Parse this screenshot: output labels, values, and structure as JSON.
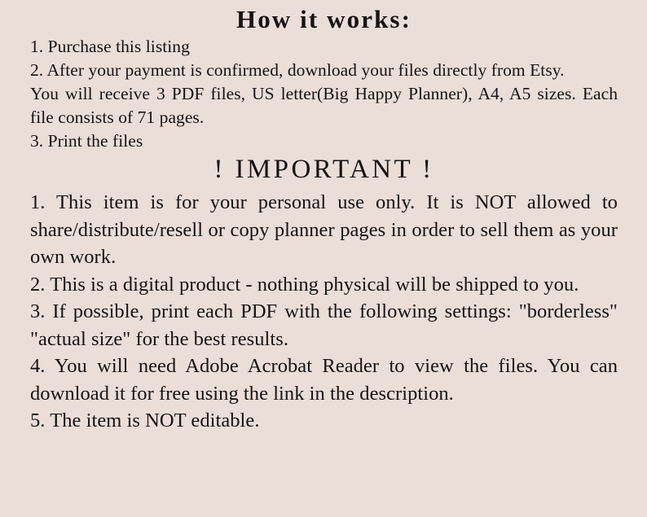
{
  "background_color": "#ebddd8",
  "text_color": "#161314",
  "sections": [
    {
      "id": "how-it-works",
      "heading": "How it works:",
      "paragraphs": [
        "1. Purchase this listing",
        "2. After your payment is confirmed, download your files directly from Etsy.",
        "You will receive 3 PDF files, US letter(Big Happy Planner), A4, A5 sizes. Each file consists of 71 pages.",
        "3. Print the files"
      ]
    },
    {
      "id": "important",
      "heading": "! IMPORTANT !",
      "paragraphs": [
        "1. This item is for your personal use only. It is NOT allowed to share/distribute/resell or copy planner pages in order to sell them as your own work.",
        "2. This is a digital product - nothing physical will be shipped to you.",
        "3. If possible, print each PDF with the following settings: \"borderless\" \"actual size\" for the best results.",
        "4. You will need Adobe Acrobat Reader to view the files. You can download it for free using the link in the description.",
        "5. The item is NOT editable."
      ]
    }
  ]
}
